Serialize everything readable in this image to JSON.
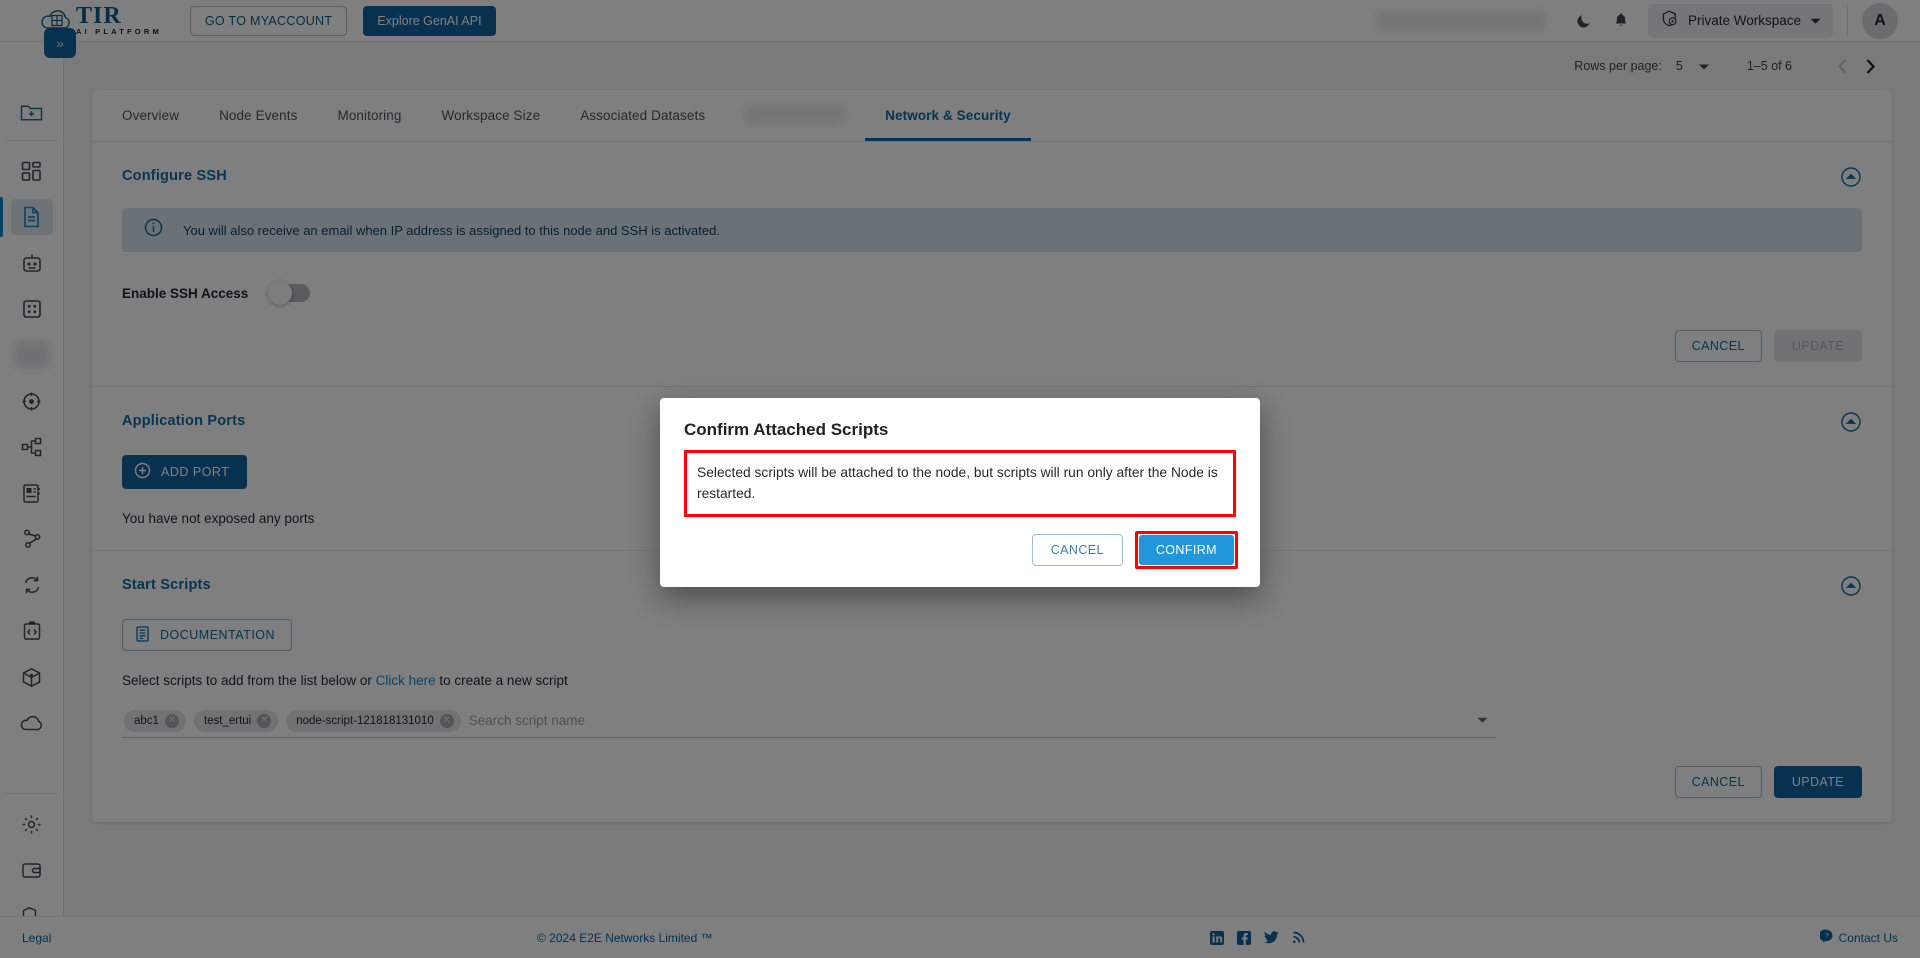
{
  "header": {
    "logo_title": "TIR",
    "logo_subtitle": "AI PLATFORM",
    "myaccount_label": "GO TO MYACCOUNT",
    "genai_label": "Explore GenAI API",
    "dark_mode_icon": "moon-icon",
    "notification_icon": "bell-icon",
    "workspace_label": "Private Workspace",
    "workspace_icon": "workspace-icon",
    "avatar_initial": "A"
  },
  "sidebar": {
    "expand_label": "»",
    "items": [
      {
        "name": "new-folder-icon",
        "label": "New Folder"
      },
      {
        "name": "dashboard-icon",
        "label": "Dashboard"
      },
      {
        "name": "notebook-document-icon",
        "label": "Notebooks",
        "active": true
      },
      {
        "name": "robot-icon",
        "label": "Models"
      },
      {
        "name": "grid-icon",
        "label": "Datasets"
      },
      {
        "name": "blurred-icon",
        "label": ""
      },
      {
        "name": "pipeline-icon",
        "label": "Pipelines"
      },
      {
        "name": "hierarchy-icon",
        "label": "Workflows"
      },
      {
        "name": "logbook-icon",
        "label": "Logs"
      },
      {
        "name": "share-icon",
        "label": "Endpoints"
      },
      {
        "name": "sync-icon",
        "label": "Sync"
      },
      {
        "name": "code-icon",
        "label": "Code"
      },
      {
        "name": "cube-icon",
        "label": "Containers"
      },
      {
        "name": "cloud-icon",
        "label": "Storage"
      }
    ],
    "bottom_items": [
      {
        "name": "gear-icon",
        "label": "Settings"
      },
      {
        "name": "wallet-icon",
        "label": "Billing"
      },
      {
        "name": "shield-icon",
        "label": "Security"
      }
    ]
  },
  "toolbar": {
    "rows_per_page_label": "Rows per page:",
    "rows_per_page_value": "5",
    "range_label": "1–5 of 6",
    "prev_icon": "chevron-left-icon",
    "next_icon": "chevron-right-icon"
  },
  "tabs": [
    {
      "label": "Overview",
      "active": false,
      "blurred": false
    },
    {
      "label": "Node Events",
      "active": false,
      "blurred": false
    },
    {
      "label": "Monitoring",
      "active": false,
      "blurred": false
    },
    {
      "label": "Workspace Size",
      "active": false,
      "blurred": false
    },
    {
      "label": "Associated Datasets",
      "active": false,
      "blurred": false
    },
    {
      "label": "",
      "active": false,
      "blurred": true
    },
    {
      "label": "Network & Security",
      "active": true,
      "blurred": false
    }
  ],
  "configure_ssh": {
    "title": "Configure SSH",
    "info_icon": "info-circle-icon",
    "info_text": "You will also receive an email when IP address is assigned to this node and SSH is activated.",
    "toggle_label": "Enable SSH Access",
    "toggle_state": "off",
    "cancel_label": "CANCEL",
    "update_label": "UPDATE",
    "update_disabled": true,
    "collapse_icon": "chevron-up-circle-icon"
  },
  "application_ports": {
    "title": "Application Ports",
    "add_port_label": "ADD PORT",
    "add_port_icon": "plus-circle-icon",
    "empty_text": "You have not exposed any ports",
    "collapse_icon": "chevron-up-circle-icon"
  },
  "start_scripts": {
    "title": "Start Scripts",
    "documentation_label": "DOCUMENTATION",
    "documentation_icon": "document-list-icon",
    "hint_prefix": "Select scripts to add from the list below or ",
    "hint_link": "Click here",
    "hint_suffix": " to create a new script",
    "chips": [
      "abc1",
      "test_ertui",
      "node-script-121818131010"
    ],
    "search_placeholder": "Search script name",
    "dropdown_icon": "chevron-down-icon",
    "cancel_label": "CANCEL",
    "update_label": "UPDATE",
    "collapse_icon": "chevron-up-circle-icon"
  },
  "modal": {
    "title": "Confirm Attached Scripts",
    "body": "Selected scripts will be attached to the node, but scripts will run only after the Node is restarted.",
    "cancel_label": "CANCEL",
    "confirm_label": "CONFIRM",
    "highlight_color": "#ff0000",
    "confirm_color": "#2196db"
  },
  "footer": {
    "legal_label": "Legal",
    "copyright": "© 2024 E2E Networks Limited ™",
    "social": [
      "linkedin-icon",
      "facebook-icon",
      "twitter-icon",
      "rss-icon"
    ],
    "contact_label": "Contact Us",
    "contact_icon": "chat-icon"
  },
  "colors": {
    "brand_blue": "#0d6ba5",
    "accent_blue": "#1063a0",
    "link_blue": "#1585c5",
    "highlight_red": "#ff0000"
  }
}
